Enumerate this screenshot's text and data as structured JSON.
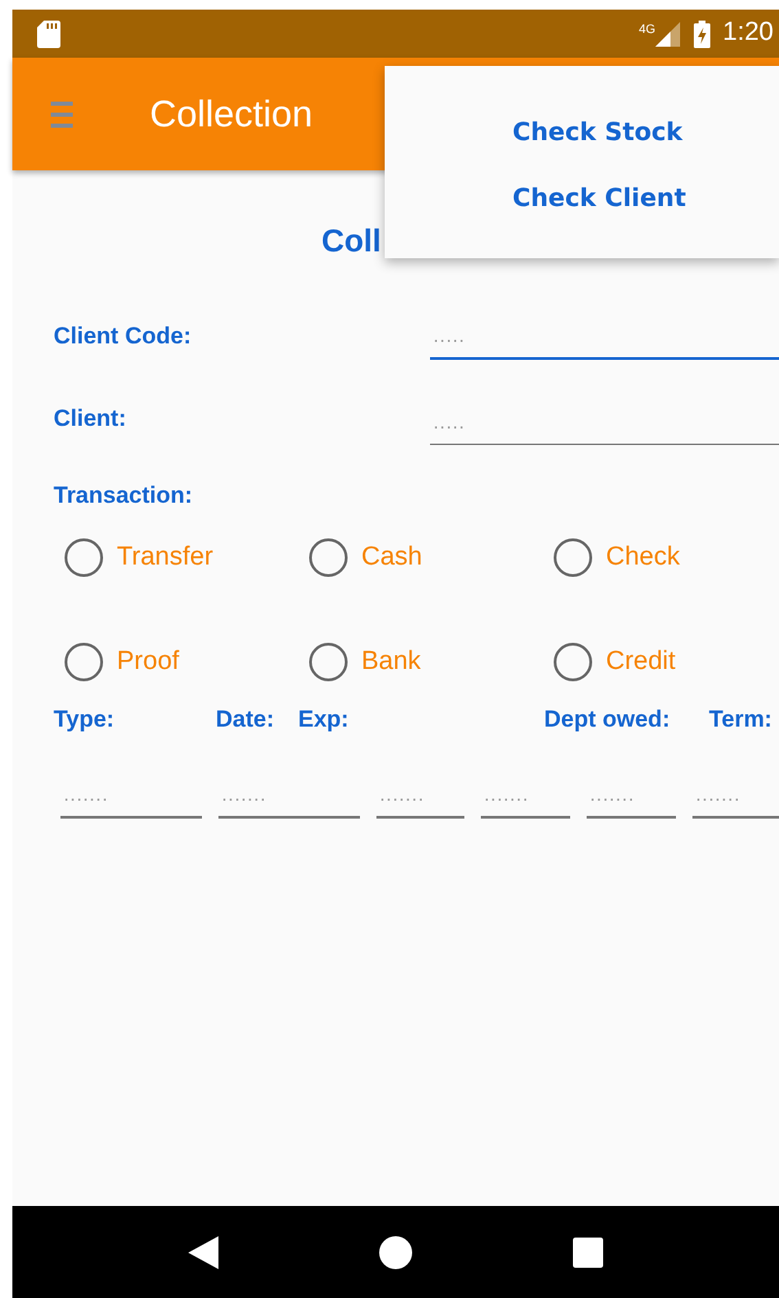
{
  "status_bar": {
    "network": "4G",
    "time": "1:20"
  },
  "toolbar": {
    "title": "Collection"
  },
  "overflow_menu": {
    "items": [
      {
        "label": "Check Stock"
      },
      {
        "label": "Check Client"
      }
    ]
  },
  "heading": "Coll",
  "fields": [
    {
      "label": "Client Code:",
      "placeholder": "·····",
      "focused": true
    },
    {
      "label": "Client:",
      "placeholder": "·····",
      "focused": false
    }
  ],
  "transaction": {
    "label": "Transaction:",
    "options": [
      {
        "label": "Transfer",
        "selected": false
      },
      {
        "label": "Cash",
        "selected": false
      },
      {
        "label": "Check",
        "selected": false
      },
      {
        "label": "Proof",
        "selected": false
      },
      {
        "label": "Bank",
        "selected": false
      },
      {
        "label": "Credit",
        "selected": false
      }
    ]
  },
  "column_labels": [
    "Type:",
    "Date:",
    "Exp:",
    "Dept owed:",
    "Term:"
  ],
  "detail_fields": [
    {
      "placeholder": "·······"
    },
    {
      "placeholder": "·······"
    },
    {
      "placeholder": "·······"
    },
    {
      "placeholder": "·······"
    },
    {
      "placeholder": "·······"
    },
    {
      "placeholder": "·······"
    }
  ]
}
